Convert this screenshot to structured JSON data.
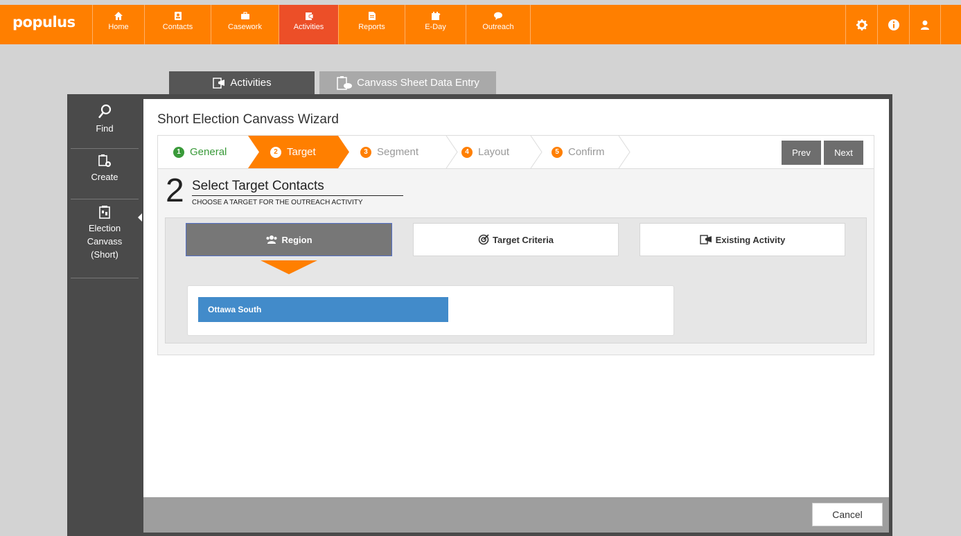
{
  "app": {
    "logo": "populus"
  },
  "nav": {
    "items": [
      {
        "label": "Home",
        "icon": "home-icon"
      },
      {
        "label": "Contacts",
        "icon": "contacts-icon"
      },
      {
        "label": "Casework",
        "icon": "casework-icon"
      },
      {
        "label": "Activities",
        "icon": "activities-icon",
        "active": true
      },
      {
        "label": "Reports",
        "icon": "reports-icon"
      },
      {
        "label": "E-Day",
        "icon": "eday-icon"
      },
      {
        "label": "Outreach",
        "icon": "outreach-icon"
      }
    ],
    "right_icons": [
      "settings-gear-icon",
      "info-icon",
      "user-icon"
    ]
  },
  "tabs": {
    "activities": "Activities",
    "canvass_entry": "Canvass Sheet Data Entry"
  },
  "sidebar": {
    "find": "Find",
    "create": "Create",
    "election_canvass": [
      "Election",
      "Canvass",
      "(Short)"
    ]
  },
  "wizard": {
    "title": "Short Election Canvass Wizard",
    "steps": [
      {
        "num": "1",
        "label": "General",
        "state": "complete"
      },
      {
        "num": "2",
        "label": "Target",
        "state": "active"
      },
      {
        "num": "3",
        "label": "Segment",
        "state": "pending"
      },
      {
        "num": "4",
        "label": "Layout",
        "state": "pending"
      },
      {
        "num": "5",
        "label": "Confirm",
        "state": "pending"
      }
    ],
    "prev": "Prev",
    "next": "Next"
  },
  "section": {
    "number": "2",
    "title": "Select Target Contacts",
    "subtitle": "CHOOSE A TARGET FOR THE OUTREACH ACTIVITY"
  },
  "options": {
    "region": "Region",
    "target_criteria": "Target Criteria",
    "existing_activity": "Existing Activity"
  },
  "region": {
    "selected": "Ottawa South"
  },
  "footer": {
    "cancel": "Cancel"
  },
  "colors": {
    "accent": "#ff7f00",
    "active_nav": "#ec4f28",
    "complete": "#3a9a3a",
    "chip": "#428bca"
  }
}
